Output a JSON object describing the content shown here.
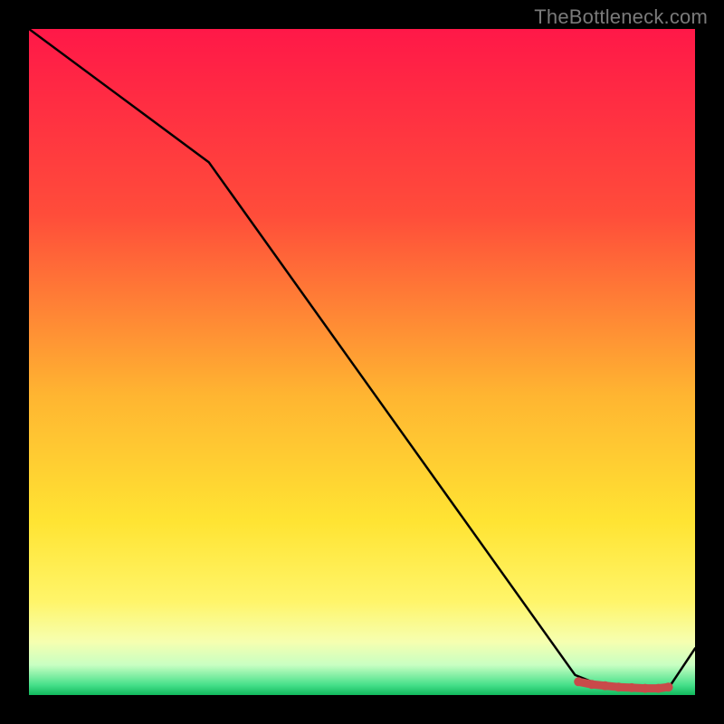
{
  "watermark": "TheBottleneck.com",
  "chart_data": {
    "type": "line",
    "title": "",
    "xlabel": "",
    "ylabel": "",
    "xlim": [
      0,
      100
    ],
    "ylim": [
      0,
      100
    ],
    "series": [
      {
        "name": "curve",
        "x": [
          0,
          27,
          82,
          87,
          96,
          100
        ],
        "y": [
          100,
          80,
          3,
          1,
          1,
          7
        ]
      }
    ],
    "markers": {
      "name": "flat-segment-dots",
      "x": [
        82.5,
        84.5,
        86.5,
        88.5,
        90.5,
        92.5,
        94.5,
        96.0
      ],
      "y": [
        2.0,
        1.6,
        1.4,
        1.2,
        1.1,
        1.0,
        1.0,
        1.2
      ]
    },
    "gradient_stops": [
      {
        "offset": 0.0,
        "color": "#ff1848"
      },
      {
        "offset": 0.28,
        "color": "#ff4d3a"
      },
      {
        "offset": 0.55,
        "color": "#ffb531"
      },
      {
        "offset": 0.74,
        "color": "#ffe433"
      },
      {
        "offset": 0.86,
        "color": "#fff56a"
      },
      {
        "offset": 0.92,
        "color": "#f6ffb0"
      },
      {
        "offset": 0.955,
        "color": "#c8ffc2"
      },
      {
        "offset": 0.985,
        "color": "#46e08a"
      },
      {
        "offset": 1.0,
        "color": "#11b85d"
      }
    ],
    "marker_color": "#c94a4a",
    "line_color": "#000000"
  }
}
